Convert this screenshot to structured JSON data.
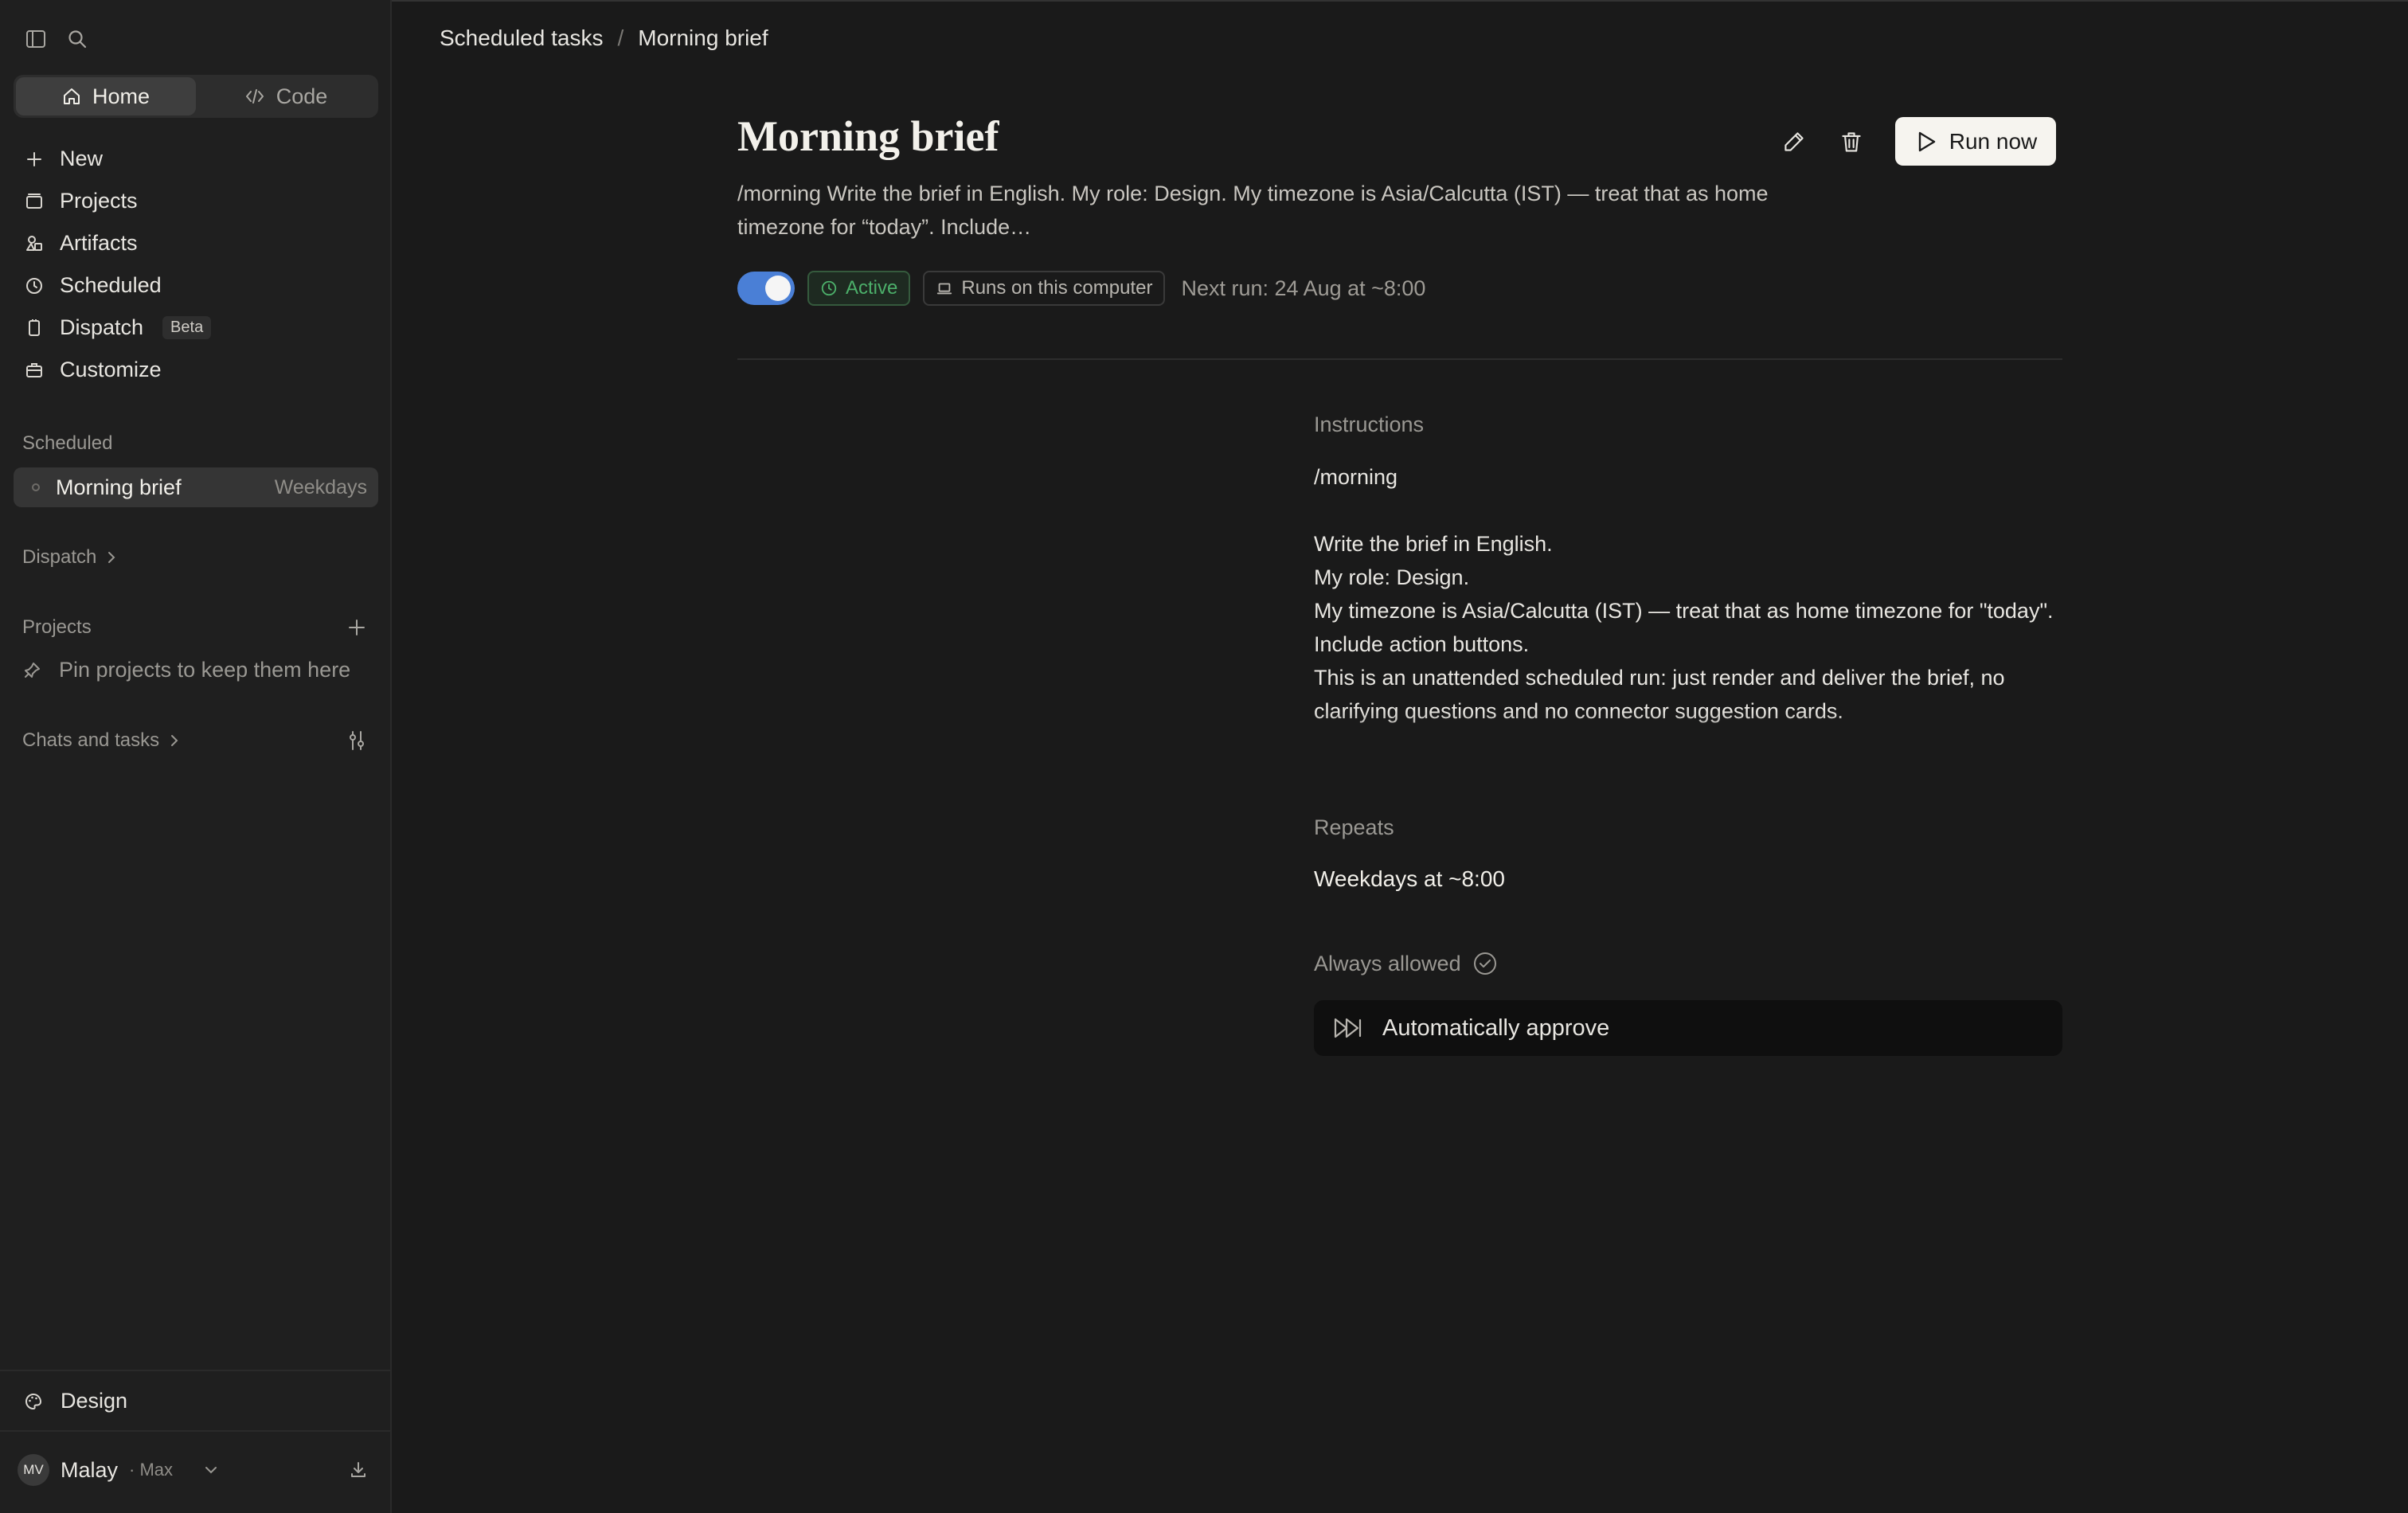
{
  "breadcrumb": {
    "parent": "Scheduled tasks",
    "separator": "/",
    "current": "Morning brief"
  },
  "sidebar": {
    "tabs": [
      {
        "label": "Home",
        "icon": "home-icon"
      },
      {
        "label": "Code",
        "icon": "code-icon"
      }
    ],
    "nav": [
      {
        "label": "New",
        "icon": "plus-icon"
      },
      {
        "label": "Projects",
        "icon": "folder-icon"
      },
      {
        "label": "Artifacts",
        "icon": "artifacts-icon"
      },
      {
        "label": "Scheduled",
        "icon": "clock-icon"
      },
      {
        "label": "Dispatch",
        "icon": "phone-icon",
        "badge": "Beta"
      },
      {
        "label": "Customize",
        "icon": "briefcase-icon"
      }
    ],
    "scheduled_header": "Scheduled",
    "scheduled_item": {
      "label": "Morning brief",
      "meta": "Weekdays"
    },
    "dispatch_header": "Dispatch",
    "projects_header": "Projects",
    "projects_empty": "Pin projects to keep them here",
    "chats_header": "Chats and tasks",
    "design_label": "Design",
    "user": {
      "initials": "MV",
      "name": "Malay",
      "plan": "· Max"
    }
  },
  "task": {
    "title": "Morning brief",
    "description": "/morning Write the brief in English. My role: Design. My timezone is Asia/Calcutta (IST) — treat that as home timezone for “today”. Include…",
    "run_label": "Run now",
    "toggle_on": true,
    "status": "Active",
    "location": "Runs on this computer",
    "next_run": "Next run: 24 Aug at ~8:00",
    "instructions_label": "Instructions",
    "instructions": [
      "/morning",
      "",
      "Write the brief in English.",
      "My role: Design.",
      "My timezone is Asia/Calcutta (IST) — treat that as home timezone for \"today\".",
      "Include action buttons.",
      "This is an unattended scheduled run: just render and deliver the brief, no clarifying questions and no connector suggestion cards."
    ],
    "repeats_label": "Repeats",
    "repeats_value": "Weekdays at ~8:00",
    "allowed_label": "Always allowed",
    "allowed_value": "Automatically approve"
  },
  "colors": {
    "accent_toggle": "#4a7fd6",
    "status_active": "#4caf6a",
    "background": "#1a1a1a",
    "sidebar": "#1f1f1f"
  }
}
